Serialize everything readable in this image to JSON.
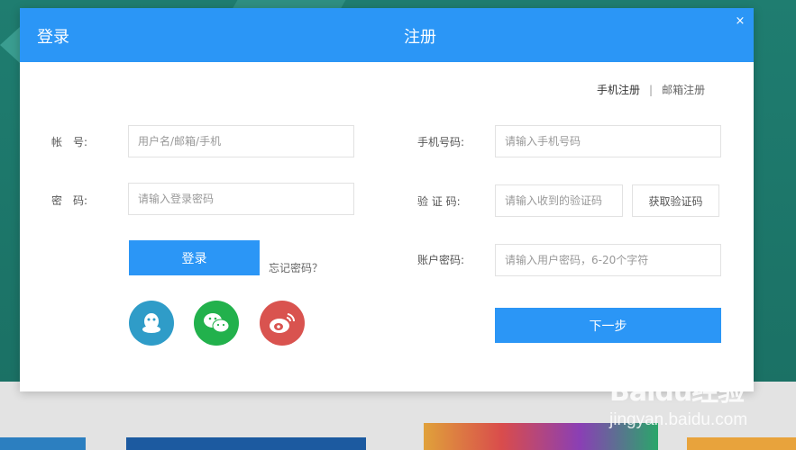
{
  "dialog": {
    "left_title": "登录",
    "center_title": "注册",
    "close_label": "×"
  },
  "tabs": {
    "phone": "手机注册",
    "separator": "|",
    "email": "邮箱注册"
  },
  "login": {
    "account_label": "帐　号:",
    "account_placeholder": "用户名/邮箱/手机",
    "password_label": "密　码:",
    "password_placeholder": "请输入登录密码",
    "login_button": "登录",
    "forgot_link": "忘记密码？",
    "social": {
      "qq": "qq-icon",
      "wechat": "wechat-icon",
      "weibo": "weibo-icon"
    }
  },
  "register": {
    "phone_label": "手机号码:",
    "phone_placeholder": "请输入手机号码",
    "code_label": "验 证 码:",
    "code_placeholder": "请输入收到的验证码",
    "get_code_button": "获取验证码",
    "password_label": "账户密码:",
    "password_placeholder": "请输入用户密码，6-20个字符",
    "next_button": "下一步"
  },
  "watermark": {
    "logo": "Baidu经验",
    "url": "jingyan.baidu.com"
  },
  "colors": {
    "primary": "#2b96f6",
    "qq": "#2f9cc8",
    "wechat": "#22b14c",
    "weibo": "#d9534f"
  }
}
